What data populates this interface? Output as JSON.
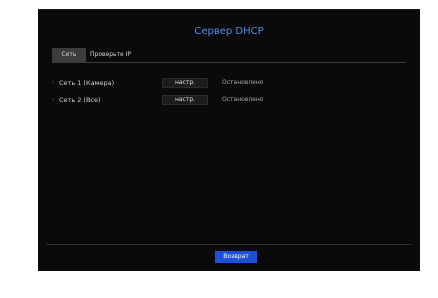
{
  "dialog": {
    "title": "Сервер DHCP",
    "tabs": [
      {
        "label": "Сеть",
        "active": true
      },
      {
        "label": "Проверьте IP",
        "active": false
      }
    ],
    "rows": [
      {
        "bullet": "›",
        "label": "Сеть 1 (Камера)",
        "button": "настр.",
        "status": "Остановлено"
      },
      {
        "bullet": "›",
        "label": "Сеть 2 (Все)",
        "button": "настр.",
        "status": "Остановлено"
      }
    ],
    "back_label": "Возврат"
  },
  "colors": {
    "title": "#4f8fe0",
    "panel_bg": "#0a0a0b",
    "accent_button": "#1e4fd6"
  }
}
